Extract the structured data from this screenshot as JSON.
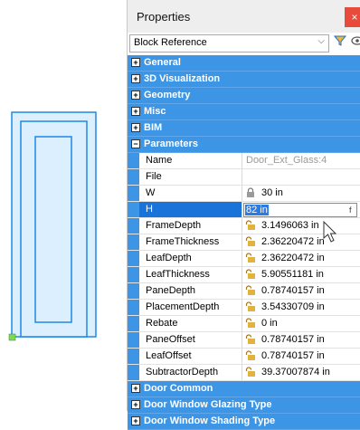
{
  "panel": {
    "title": "Properties",
    "close_label": "×",
    "selector_value": "Block Reference",
    "selector_chevron": "⌵",
    "filter_icon": "filter-icon",
    "view_icon": "eye-icon"
  },
  "categories_top": [
    {
      "label": "General",
      "expander": "+"
    },
    {
      "label": "3D Visualization",
      "expander": "+"
    },
    {
      "label": "Geometry",
      "expander": "+"
    },
    {
      "label": "Misc",
      "expander": "+"
    },
    {
      "label": "BIM",
      "expander": "+"
    },
    {
      "label": "Parameters",
      "expander": "−"
    }
  ],
  "parameters": [
    {
      "name": "Name",
      "value": "Door_Ext_Glass:4"
    },
    {
      "name": "File",
      "value": ""
    },
    {
      "name": "W",
      "value": "30 in"
    },
    {
      "name": "H",
      "value": "82 in",
      "edit_button": "f"
    },
    {
      "name": "FrameDepth",
      "value": "3.1496063 in"
    },
    {
      "name": "FrameThickness",
      "value": "2.36220472 in"
    },
    {
      "name": "LeafDepth",
      "value": "2.36220472 in"
    },
    {
      "name": "LeafThickness",
      "value": "5.90551181 in"
    },
    {
      "name": "PaneDepth",
      "value": "0.78740157 in"
    },
    {
      "name": "PlacementDepth",
      "value": "3.54330709 in"
    },
    {
      "name": "Rebate",
      "value": "0 in"
    },
    {
      "name": "PaneOffset",
      "value": "0.78740157 in"
    },
    {
      "name": "LeafOffset",
      "value": "0.78740157 in"
    },
    {
      "name": "SubtractorDepth",
      "value": "39.37007874 in"
    }
  ],
  "categories_bottom": [
    {
      "label": "Door Common",
      "expander": "+"
    },
    {
      "label": "Door Window Glazing Type",
      "expander": "+"
    },
    {
      "label": "Door Window Shading Type",
      "expander": "+"
    }
  ],
  "colors": {
    "category_blue": "#3d95e6",
    "selection_blue": "#1a73d8",
    "drawing_blue": "#1e88e5",
    "grip_green": "#7ed957"
  }
}
